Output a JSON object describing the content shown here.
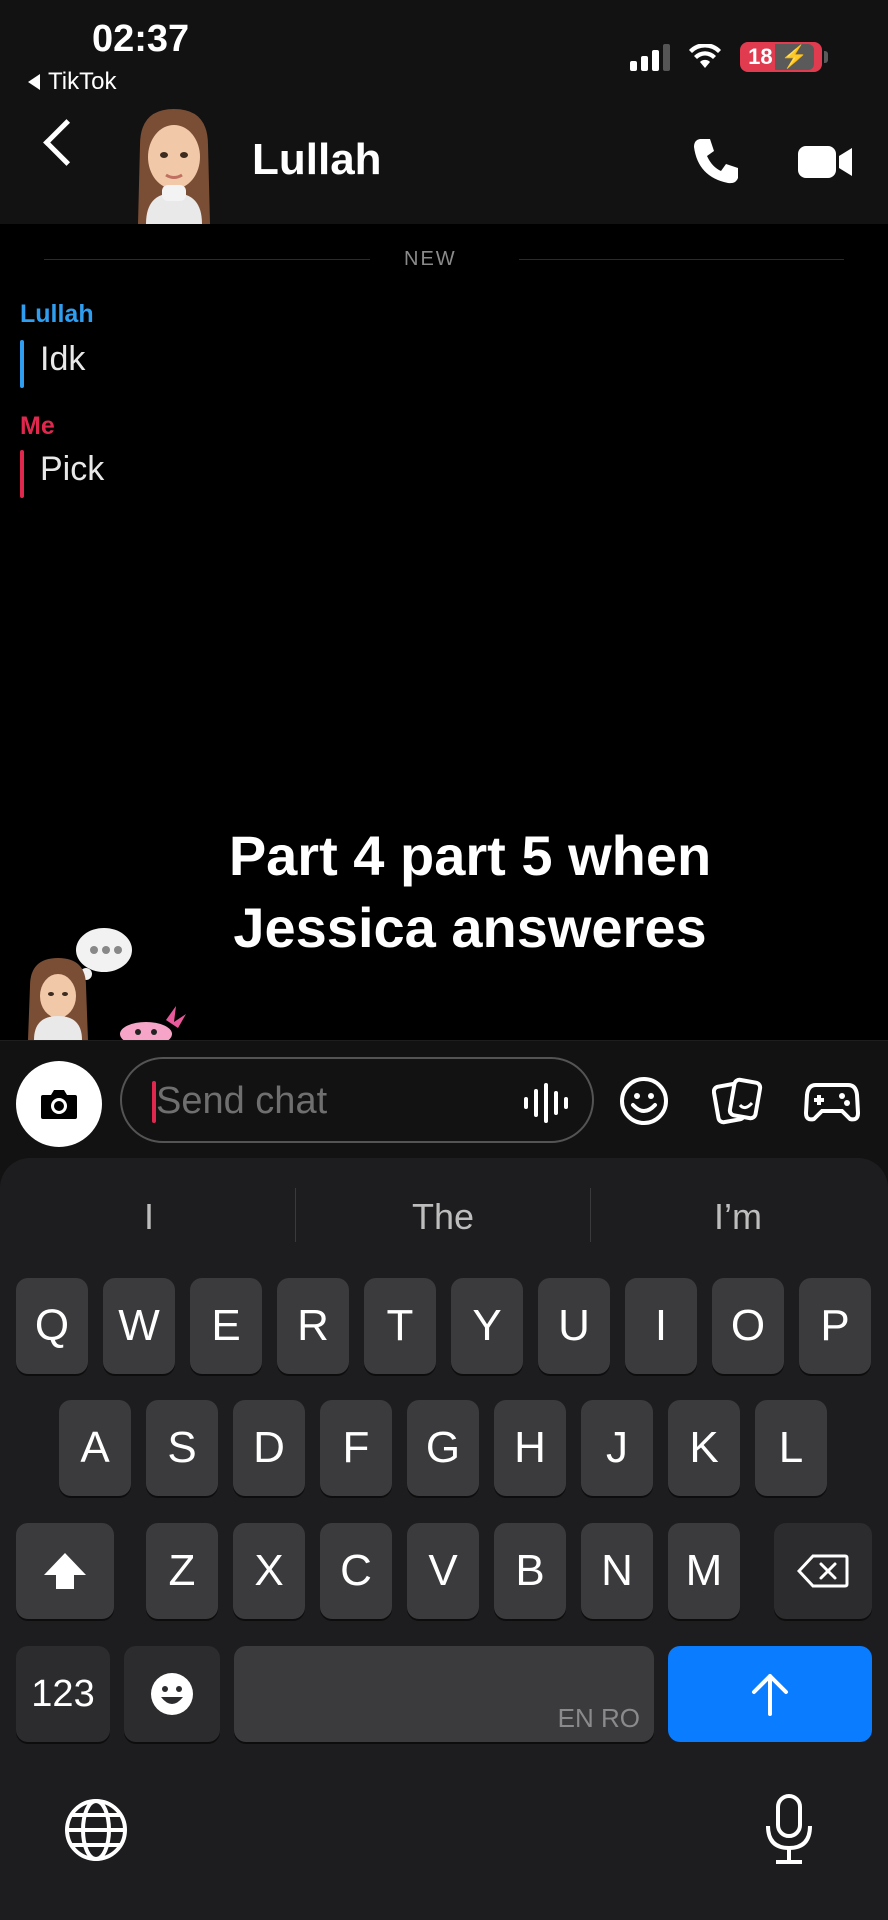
{
  "status_bar": {
    "time": "02:37",
    "back_app": "TikTok",
    "battery": "18",
    "battery_rest": "⚡"
  },
  "header": {
    "contact_name": "Lullah"
  },
  "chat": {
    "separator": "NEW",
    "messages": [
      {
        "sender": "Lullah",
        "text": "Idk",
        "color": "#2f9ef0"
      },
      {
        "sender": "Me",
        "text": "Pick",
        "color": "#e0284e"
      }
    ]
  },
  "overlay": {
    "line1": "Part 4 part 5 when",
    "line2": "Jessica answeres"
  },
  "input": {
    "placeholder": "Send chat"
  },
  "keyboard": {
    "suggestions": [
      "I",
      "The",
      "I’m"
    ],
    "row1": [
      "Q",
      "W",
      "E",
      "R",
      "T",
      "Y",
      "U",
      "I",
      "O",
      "P"
    ],
    "row2": [
      "A",
      "S",
      "D",
      "F",
      "G",
      "H",
      "J",
      "K",
      "L"
    ],
    "row3": [
      "Z",
      "X",
      "C",
      "V",
      "B",
      "N",
      "M"
    ],
    "numbers_key": "123",
    "language": "EN RO"
  },
  "colors": {
    "accent_blue": "#0a7cff",
    "me_red": "#e0284e",
    "friend_blue": "#2f9ef0"
  }
}
